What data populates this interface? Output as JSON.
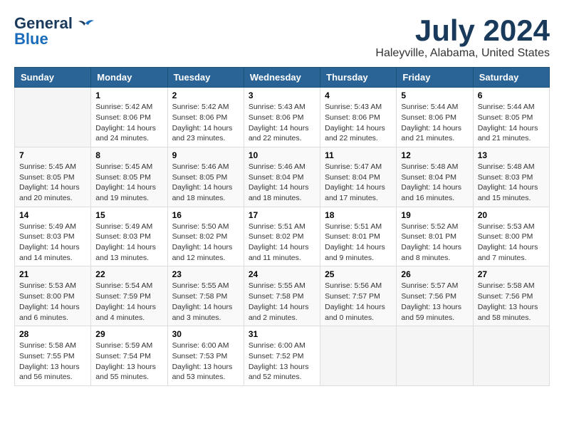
{
  "header": {
    "logo_line1": "General",
    "logo_line2": "Blue",
    "month_title": "July 2024",
    "location": "Haleyville, Alabama, United States"
  },
  "days_of_week": [
    "Sunday",
    "Monday",
    "Tuesday",
    "Wednesday",
    "Thursday",
    "Friday",
    "Saturday"
  ],
  "weeks": [
    [
      {
        "day": "",
        "info": ""
      },
      {
        "day": "1",
        "info": "Sunrise: 5:42 AM\nSunset: 8:06 PM\nDaylight: 14 hours\nand 24 minutes."
      },
      {
        "day": "2",
        "info": "Sunrise: 5:42 AM\nSunset: 8:06 PM\nDaylight: 14 hours\nand 23 minutes."
      },
      {
        "day": "3",
        "info": "Sunrise: 5:43 AM\nSunset: 8:06 PM\nDaylight: 14 hours\nand 22 minutes."
      },
      {
        "day": "4",
        "info": "Sunrise: 5:43 AM\nSunset: 8:06 PM\nDaylight: 14 hours\nand 22 minutes."
      },
      {
        "day": "5",
        "info": "Sunrise: 5:44 AM\nSunset: 8:06 PM\nDaylight: 14 hours\nand 21 minutes."
      },
      {
        "day": "6",
        "info": "Sunrise: 5:44 AM\nSunset: 8:05 PM\nDaylight: 14 hours\nand 21 minutes."
      }
    ],
    [
      {
        "day": "7",
        "info": "Sunrise: 5:45 AM\nSunset: 8:05 PM\nDaylight: 14 hours\nand 20 minutes."
      },
      {
        "day": "8",
        "info": "Sunrise: 5:45 AM\nSunset: 8:05 PM\nDaylight: 14 hours\nand 19 minutes."
      },
      {
        "day": "9",
        "info": "Sunrise: 5:46 AM\nSunset: 8:05 PM\nDaylight: 14 hours\nand 18 minutes."
      },
      {
        "day": "10",
        "info": "Sunrise: 5:46 AM\nSunset: 8:04 PM\nDaylight: 14 hours\nand 18 minutes."
      },
      {
        "day": "11",
        "info": "Sunrise: 5:47 AM\nSunset: 8:04 PM\nDaylight: 14 hours\nand 17 minutes."
      },
      {
        "day": "12",
        "info": "Sunrise: 5:48 AM\nSunset: 8:04 PM\nDaylight: 14 hours\nand 16 minutes."
      },
      {
        "day": "13",
        "info": "Sunrise: 5:48 AM\nSunset: 8:03 PM\nDaylight: 14 hours\nand 15 minutes."
      }
    ],
    [
      {
        "day": "14",
        "info": "Sunrise: 5:49 AM\nSunset: 8:03 PM\nDaylight: 14 hours\nand 14 minutes."
      },
      {
        "day": "15",
        "info": "Sunrise: 5:49 AM\nSunset: 8:03 PM\nDaylight: 14 hours\nand 13 minutes."
      },
      {
        "day": "16",
        "info": "Sunrise: 5:50 AM\nSunset: 8:02 PM\nDaylight: 14 hours\nand 12 minutes."
      },
      {
        "day": "17",
        "info": "Sunrise: 5:51 AM\nSunset: 8:02 PM\nDaylight: 14 hours\nand 11 minutes."
      },
      {
        "day": "18",
        "info": "Sunrise: 5:51 AM\nSunset: 8:01 PM\nDaylight: 14 hours\nand 9 minutes."
      },
      {
        "day": "19",
        "info": "Sunrise: 5:52 AM\nSunset: 8:01 PM\nDaylight: 14 hours\nand 8 minutes."
      },
      {
        "day": "20",
        "info": "Sunrise: 5:53 AM\nSunset: 8:00 PM\nDaylight: 14 hours\nand 7 minutes."
      }
    ],
    [
      {
        "day": "21",
        "info": "Sunrise: 5:53 AM\nSunset: 8:00 PM\nDaylight: 14 hours\nand 6 minutes."
      },
      {
        "day": "22",
        "info": "Sunrise: 5:54 AM\nSunset: 7:59 PM\nDaylight: 14 hours\nand 4 minutes."
      },
      {
        "day": "23",
        "info": "Sunrise: 5:55 AM\nSunset: 7:58 PM\nDaylight: 14 hours\nand 3 minutes."
      },
      {
        "day": "24",
        "info": "Sunrise: 5:55 AM\nSunset: 7:58 PM\nDaylight: 14 hours\nand 2 minutes."
      },
      {
        "day": "25",
        "info": "Sunrise: 5:56 AM\nSunset: 7:57 PM\nDaylight: 14 hours\nand 0 minutes."
      },
      {
        "day": "26",
        "info": "Sunrise: 5:57 AM\nSunset: 7:56 PM\nDaylight: 13 hours\nand 59 minutes."
      },
      {
        "day": "27",
        "info": "Sunrise: 5:58 AM\nSunset: 7:56 PM\nDaylight: 13 hours\nand 58 minutes."
      }
    ],
    [
      {
        "day": "28",
        "info": "Sunrise: 5:58 AM\nSunset: 7:55 PM\nDaylight: 13 hours\nand 56 minutes."
      },
      {
        "day": "29",
        "info": "Sunrise: 5:59 AM\nSunset: 7:54 PM\nDaylight: 13 hours\nand 55 minutes."
      },
      {
        "day": "30",
        "info": "Sunrise: 6:00 AM\nSunset: 7:53 PM\nDaylight: 13 hours\nand 53 minutes."
      },
      {
        "day": "31",
        "info": "Sunrise: 6:00 AM\nSunset: 7:52 PM\nDaylight: 13 hours\nand 52 minutes."
      },
      {
        "day": "",
        "info": ""
      },
      {
        "day": "",
        "info": ""
      },
      {
        "day": "",
        "info": ""
      }
    ]
  ]
}
